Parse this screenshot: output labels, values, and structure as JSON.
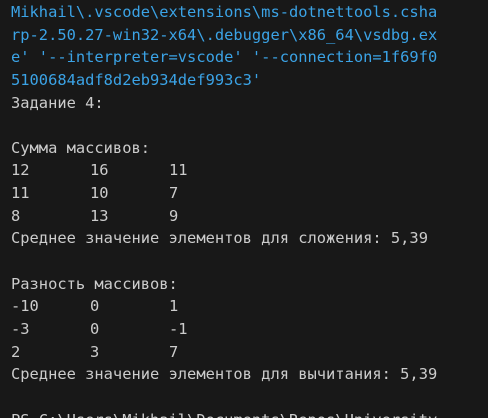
{
  "colors": {
    "background": "#181818",
    "text": "#cccccc",
    "command_text": "#3ba3e6"
  },
  "command": {
    "lines": [
      "Mikhail\\.vscode\\extensions\\ms-dotnettools.csha",
      "rp-2.50.27-win32-x64\\.debugger\\x86_64\\vsdbg.ex",
      "e' '--interpreter=vscode' '--connection=1f69f0",
      "5100684adf8d2eb934def993c3'"
    ]
  },
  "output": {
    "task_title": "Задание 4:",
    "sum_title": "Сумма массивов:",
    "sum_rows": [
      [
        "12",
        "16",
        "11"
      ],
      [
        "11",
        "10",
        "7"
      ],
      [
        "8",
        "13",
        "9"
      ]
    ],
    "sum_average": "Среднее значение элементов для сложения: 5,39",
    "diff_title": "Разность массивов:",
    "diff_rows": [
      [
        "-10",
        "0",
        "1"
      ],
      [
        "-3",
        "0",
        "-1"
      ],
      [
        "2",
        "3",
        "7"
      ]
    ],
    "diff_average": "Среднее значение элементов для вычитания: 5,39"
  },
  "prompt": {
    "text": "PS C:\\Users\\Mikhail\\Documents\\Repos\\University"
  }
}
